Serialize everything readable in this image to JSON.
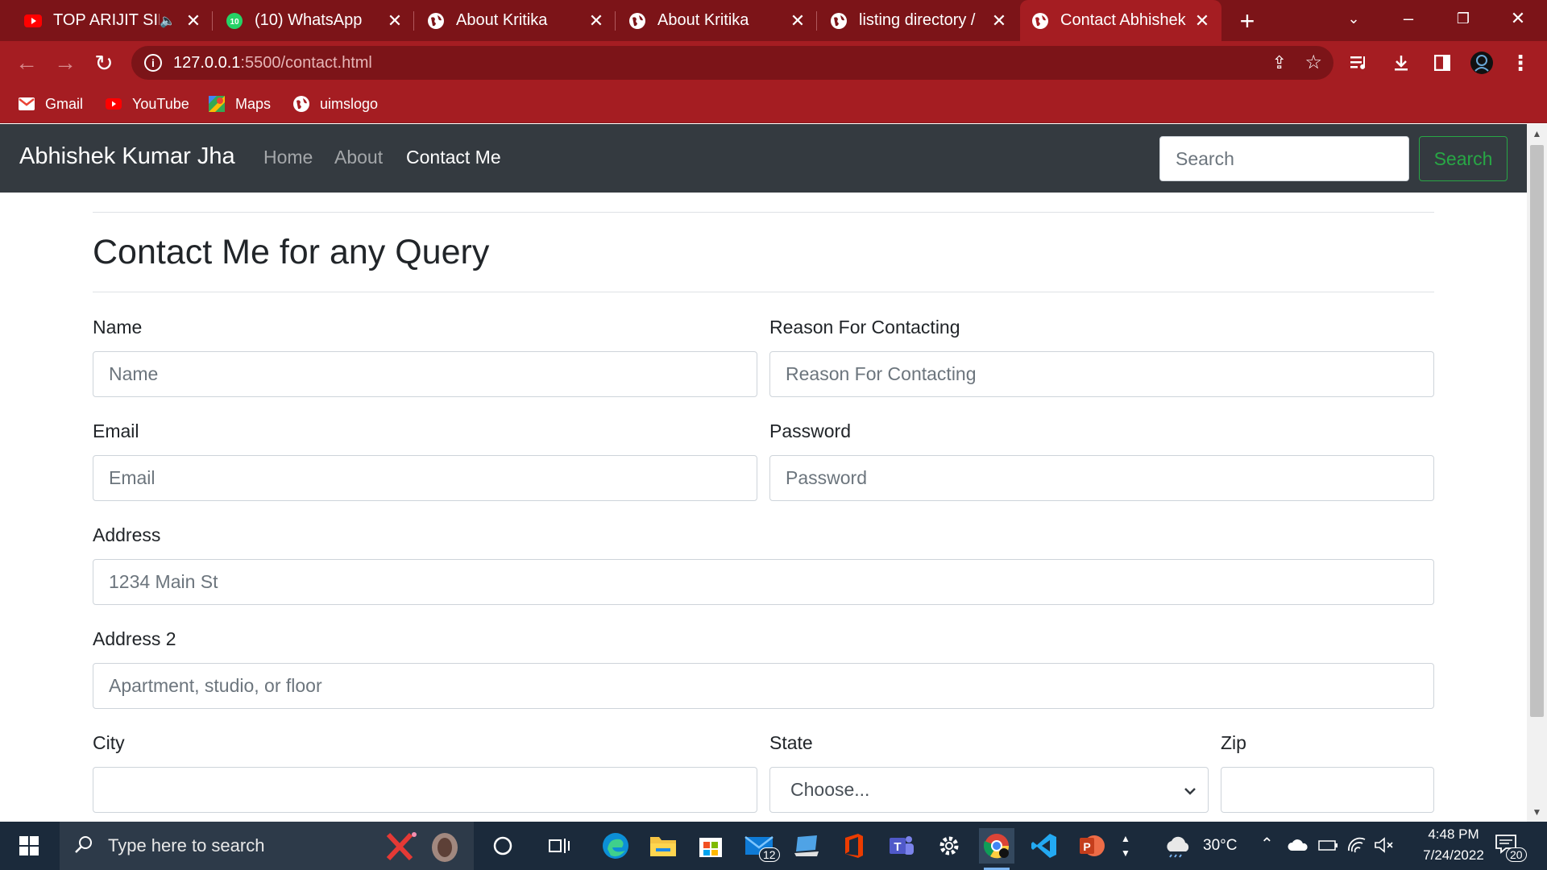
{
  "browser": {
    "tabs": [
      {
        "label": "TOP ARIJIT SIN",
        "icon": "youtube-icon",
        "muted_audio": true
      },
      {
        "label": "(10) WhatsApp",
        "icon": "whatsapp-icon",
        "badge": "10"
      },
      {
        "label": "About Kritika",
        "icon": "globe-icon"
      },
      {
        "label": "About Kritika",
        "icon": "globe-icon"
      },
      {
        "label": "listing directory /",
        "icon": "globe-icon"
      },
      {
        "label": "Contact Abhishek",
        "icon": "globe-icon",
        "active": true
      }
    ],
    "url_host": "127.0.0.1",
    "url_rest": ":5500/contact.html",
    "bookmarks": [
      {
        "label": "Gmail",
        "icon": "gmail-icon"
      },
      {
        "label": "YouTube",
        "icon": "youtube-icon"
      },
      {
        "label": "Maps",
        "icon": "maps-icon"
      },
      {
        "label": "uimslogo",
        "icon": "globe-icon"
      }
    ],
    "theme_color": "#a51d22",
    "tabbar_color": "#7c1418"
  },
  "site": {
    "brand": "Abhishek Kumar Jha",
    "nav_links": [
      "Home",
      "About",
      "Contact Me"
    ],
    "active_nav": "Contact Me",
    "search_placeholder": "Search",
    "search_button": "Search",
    "navbar_color": "#343a40",
    "search_button_color": "#28a745"
  },
  "form": {
    "title": "Contact Me for any Query",
    "name": {
      "label": "Name",
      "placeholder": "Name"
    },
    "reason": {
      "label": "Reason For Contacting",
      "placeholder": "Reason For Contacting"
    },
    "email": {
      "label": "Email",
      "placeholder": "Email"
    },
    "password": {
      "label": "Password",
      "placeholder": "Password"
    },
    "address": {
      "label": "Address",
      "placeholder": "1234 Main St"
    },
    "address2": {
      "label": "Address 2",
      "placeholder": "Apartment, studio, or floor"
    },
    "city": {
      "label": "City",
      "value": ""
    },
    "state": {
      "label": "State",
      "selected": "Choose..."
    },
    "zip": {
      "label": "Zip",
      "value": ""
    }
  },
  "taskbar": {
    "search_placeholder": "Type here to search",
    "mail_badge": "12",
    "temperature": "30°C",
    "time": "4:48 PM",
    "date": "7/24/2022",
    "notification_count": "20",
    "background": "#1b2a3b"
  }
}
